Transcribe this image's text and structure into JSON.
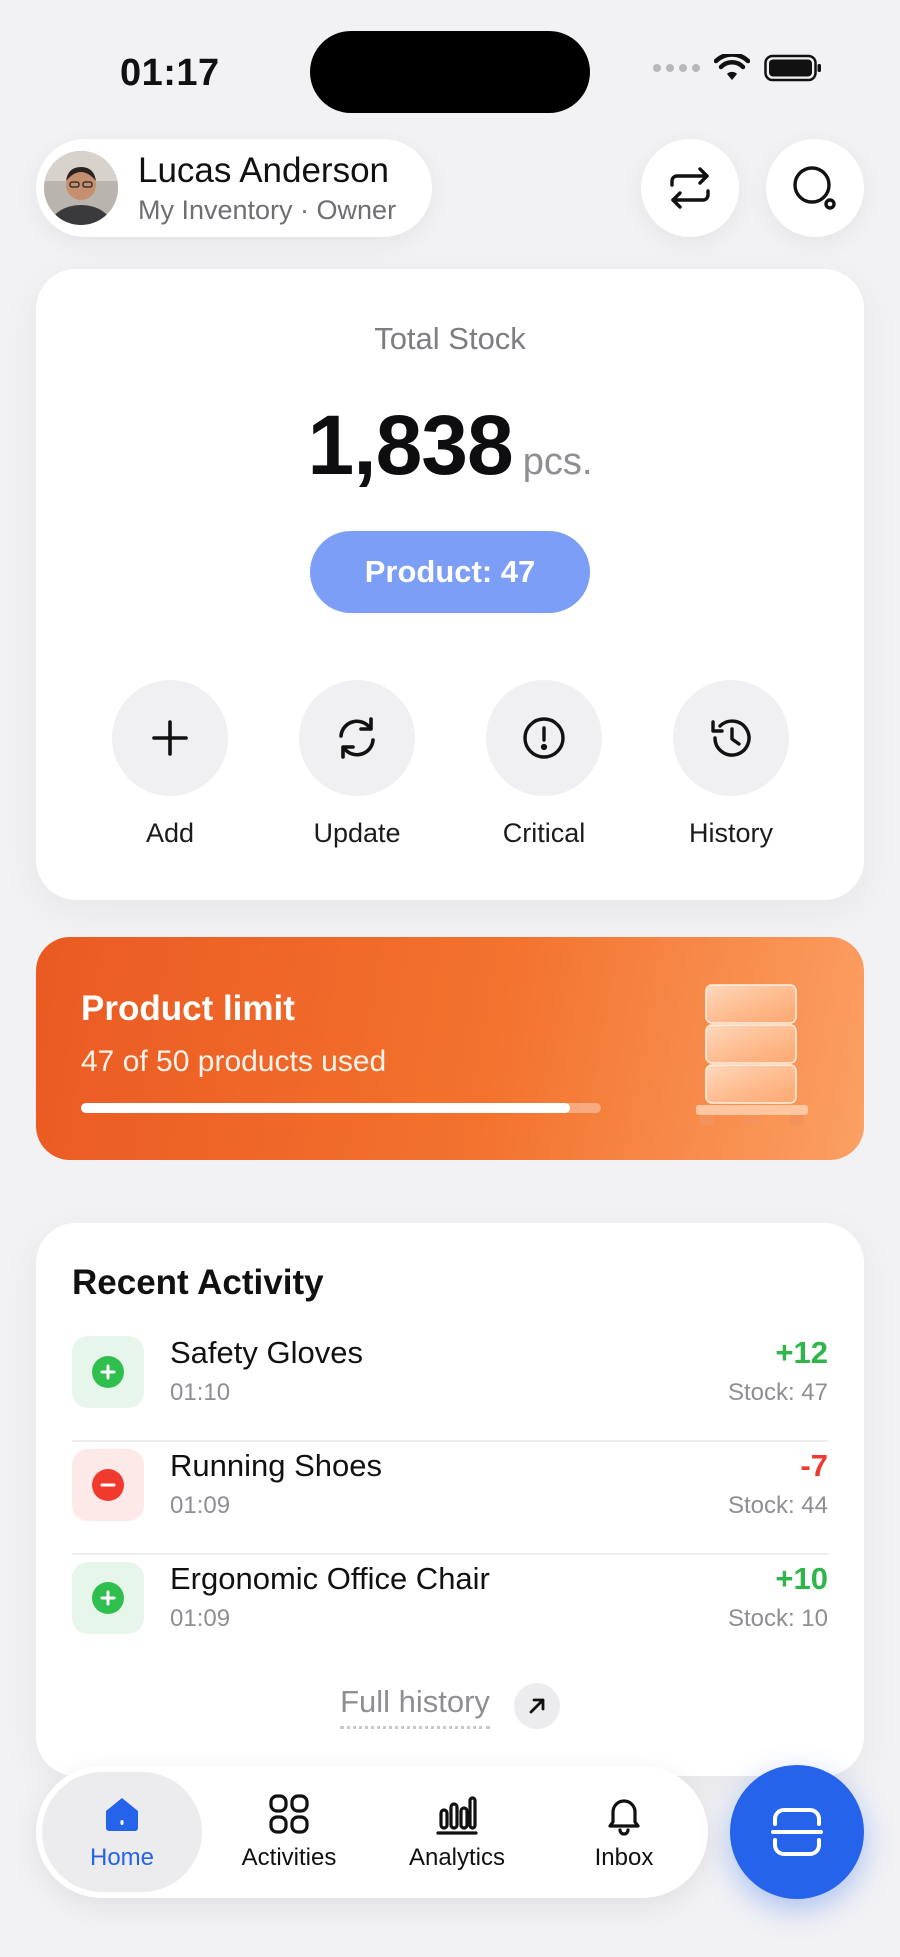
{
  "status_bar": {
    "time": "01:17"
  },
  "header": {
    "user_name": "Lucas Anderson",
    "user_subtitle": "My Inventory · Owner",
    "avatar_icon": "user-avatar",
    "switch_icon": "repeat-arrows-icon",
    "search_icon": "search-icon"
  },
  "stock": {
    "label": "Total Stock",
    "value": "1,838",
    "unit": "pcs.",
    "product_pill": "Product: 47",
    "accent_color": "#7d9ef7",
    "actions": [
      {
        "label": "Add",
        "icon": "plus-icon"
      },
      {
        "label": "Update",
        "icon": "refresh-icon"
      },
      {
        "label": "Critical",
        "icon": "alert-circle-icon"
      },
      {
        "label": "History",
        "icon": "history-icon"
      }
    ]
  },
  "limit": {
    "title": "Product limit",
    "subtitle": "47 of 50 products used",
    "progress_percent": 94,
    "colors": [
      "#ea5a22",
      "#fba063"
    ]
  },
  "activity": {
    "title": "Recent Activity",
    "items": [
      {
        "name": "Safety Gloves",
        "time": "01:10",
        "delta": "+12",
        "stock": "Stock: 47",
        "type": "plus"
      },
      {
        "name": "Running Shoes",
        "time": "01:09",
        "delta": "-7",
        "stock": "Stock: 44",
        "type": "minus"
      },
      {
        "name": "Ergonomic Office Chair",
        "time": "01:09",
        "delta": "+10",
        "stock": "Stock: 10",
        "type": "plus"
      }
    ],
    "full_history": "Full history"
  },
  "tabbar": {
    "tabs": [
      {
        "label": "Home",
        "icon": "home-icon",
        "active": true
      },
      {
        "label": "Activities",
        "icon": "grid-icon",
        "active": false
      },
      {
        "label": "Analytics",
        "icon": "bar-chart-icon",
        "active": false
      },
      {
        "label": "Inbox",
        "icon": "bell-icon",
        "active": false
      }
    ],
    "scan_icon": "scan-icon",
    "active_color": "#2563eb"
  }
}
